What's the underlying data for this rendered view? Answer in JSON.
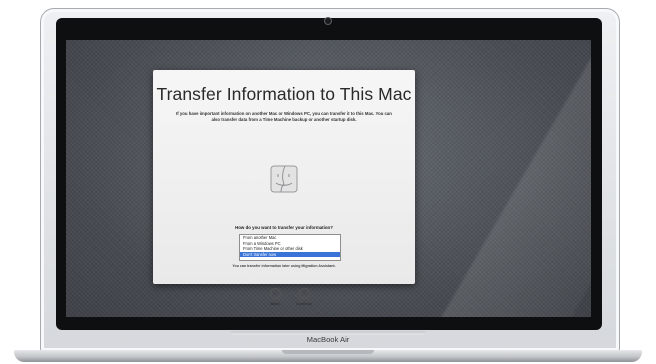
{
  "dialog": {
    "title": "Transfer Information to This Mac",
    "description": "If you have important information on another Mac or Windows PC, you can transfer it to this Mac. You can also transfer data from a Time Machine backup or another startup disk.",
    "question": "How do you want to transfer your information?",
    "options": [
      {
        "label": "From another Mac",
        "selected": false
      },
      {
        "label": "From a Windows PC",
        "selected": false
      },
      {
        "label": "From Time Machine or other disk",
        "selected": false
      },
      {
        "label": "Don't transfer now",
        "selected": true
      }
    ],
    "note": "You can transfer information later using Migration Assistant.",
    "back_label": "Back",
    "continue_label": "Continue"
  },
  "device": {
    "brand_label": "MacBook Air"
  },
  "colors": {
    "selection": "#3a74d6",
    "wallpaper": "#4b4f55"
  },
  "icons": [
    "finder-icon",
    "back-arrow-icon",
    "continue-arrow-icon"
  ]
}
